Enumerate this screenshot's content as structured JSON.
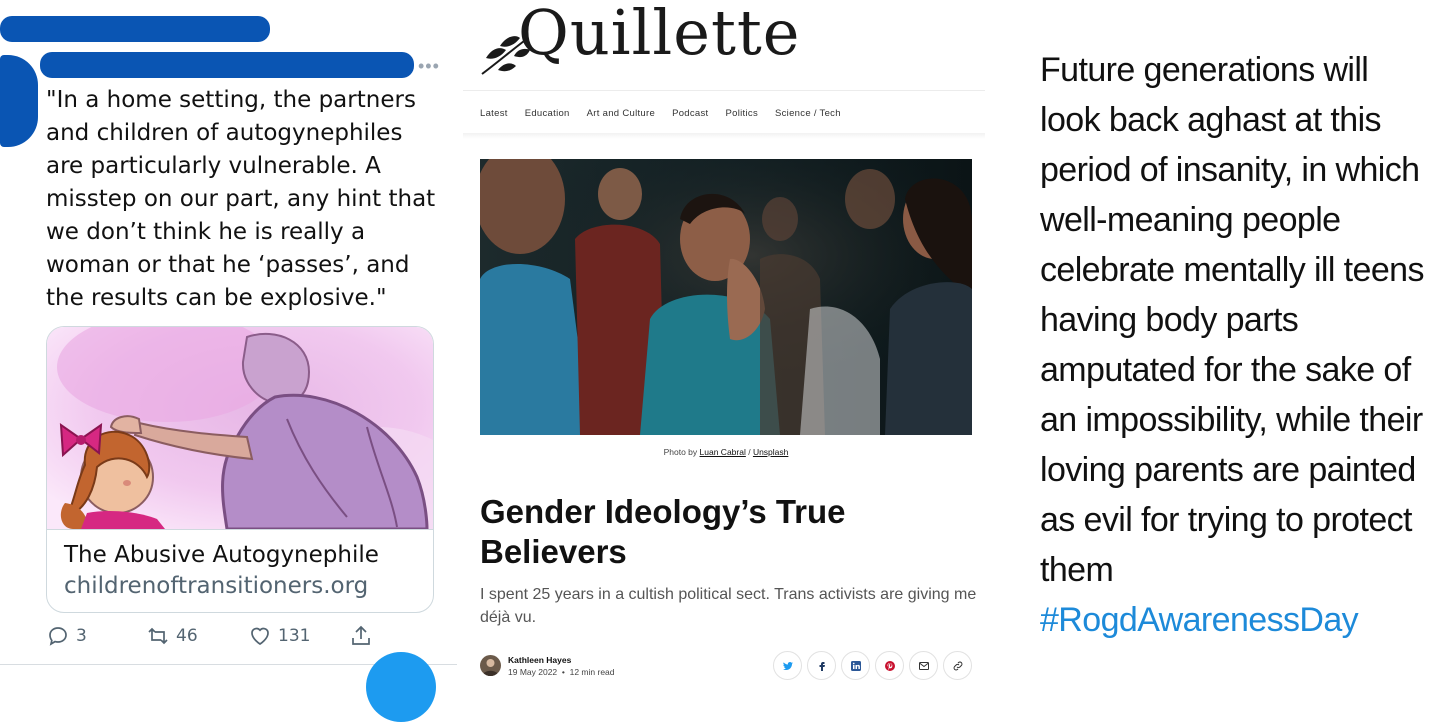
{
  "tweet": {
    "text": "\"In a home setting, the partners\nand children of autogynephiles\nare particularly vulnerable. A\nmisstep on our part, any hint that\nwe don’t think he is really a\nwoman or that he ‘passes’, and\nthe results can be explosive.\"",
    "more_glyph": "•••",
    "card": {
      "title": "The Abusive Autogynephile",
      "domain": "childrenoftransitioners.org"
    },
    "actions": {
      "replies": "3",
      "retweets": "46",
      "likes": "131"
    },
    "colors": {
      "redaction": "#0a55b3",
      "link_blue": "#1d9bf0",
      "muted": "#536471"
    }
  },
  "quillette": {
    "logo": "Quillette",
    "nav": [
      "Latest",
      "Education",
      "Art and Culture",
      "Podcast",
      "Politics",
      "Science / Tech"
    ],
    "caption": {
      "prefix": "Photo by ",
      "photographer": "Luan Cabral",
      "separator": " / ",
      "source": "Unsplash"
    },
    "headline": "Gender Ideology’s True Believers",
    "dek": "I spent 25 years in a cultish political sect. Trans activists are giving me déjà vu.",
    "author": "Kathleen Hayes",
    "date": "19 May 2022",
    "bullet": "•",
    "read_time": "12 min read",
    "share_icons": [
      "twitter-icon",
      "facebook-icon",
      "linkedin-icon",
      "pinterest-icon",
      "email-icon",
      "link-icon"
    ]
  },
  "quote": {
    "text": "Future generations will\nlook back aghast at this\nperiod of insanity, in which\nwell-meaning people\ncelebrate mentally ill teens\nhaving body parts\namputated for the sake of\nan impossibility, while their\nloving parents are painted\nas evil for trying to protect\nthem",
    "hashtag": "#RogdAwarenessDay",
    "hashtag_color": "#1d8ad9"
  }
}
